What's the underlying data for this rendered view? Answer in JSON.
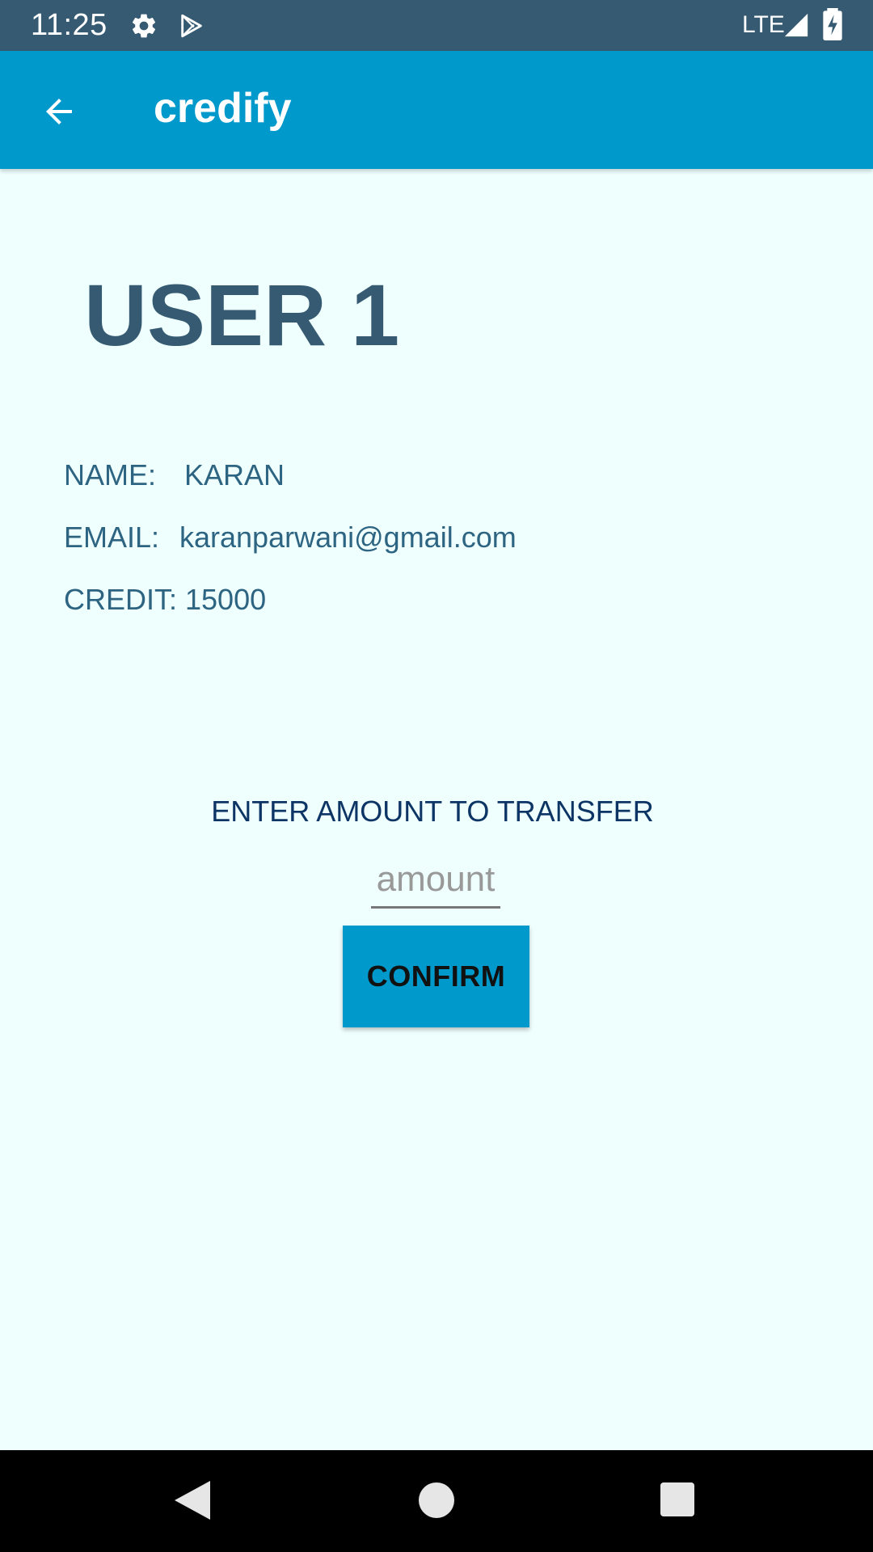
{
  "status_bar": {
    "time": "11:25",
    "network": "LTE",
    "icons": [
      "gear-icon",
      "play-store-icon",
      "signal-icon",
      "battery-icon"
    ]
  },
  "app_bar": {
    "title": "credify",
    "back_icon": "arrow-left-icon",
    "color": "#0099cc"
  },
  "user": {
    "heading": "USER 1",
    "name_label": "NAME:",
    "name_value": "KARAN",
    "email_label": "EMAIL:",
    "email_value": "karanparwani@gmail.com",
    "credit_label": "CREDIT:",
    "credit_value": "15000"
  },
  "transfer": {
    "label": "ENTER AMOUNT TO TRANSFER",
    "input_value": "",
    "input_placeholder": "amount",
    "confirm_label": "CONFIRM"
  },
  "nav_bar": {
    "icons": [
      "nav-back-icon",
      "nav-home-icon",
      "nav-recent-icon"
    ]
  },
  "colors": {
    "background": "#effffe",
    "status_bar": "#355a72",
    "accent": "#0099cc",
    "heading": "#355a72",
    "info_text": "#2d6482",
    "transfer_label": "#0c3464"
  }
}
